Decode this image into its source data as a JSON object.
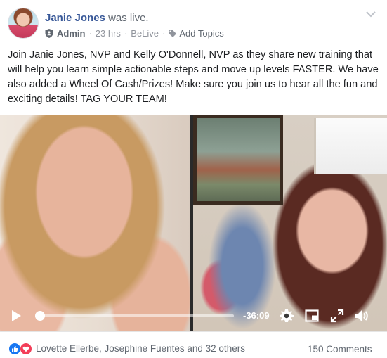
{
  "post": {
    "author": "Janie Jones",
    "action": "was live.",
    "role": "Admin",
    "time": "23 hrs",
    "app": "BeLive",
    "add_topics": "Add Topics",
    "separator": "·",
    "body": "Join Janie Jones, NVP and Kelly O'Donnell, NVP as they share new training that will help you learn simple actionable steps and move up levels FASTER. We have also added a Wheel Of Cash/Prizes! Make sure you join us to hear all the fun and exciting details! TAG YOUR TEAM!"
  },
  "video": {
    "time_remaining": "-36:09",
    "progress": 0.02
  },
  "footer": {
    "reactions_text": "Lovette Ellerbe, Josephine Fuentes and 32 others",
    "comments_text": "150 Comments"
  },
  "icons": {
    "role": "shield-icon",
    "topics": "tag-icon",
    "menu": "chevron-down-icon",
    "play": "play-icon",
    "settings": "gear-icon",
    "pip": "picture-in-picture-icon",
    "fullscreen": "expand-icon",
    "volume": "volume-icon",
    "like": "like-reaction-icon",
    "love": "love-reaction-icon"
  },
  "colors": {
    "link": "#385898",
    "meta": "#90949c",
    "like": "#1877f2",
    "love": "#f33e58"
  }
}
